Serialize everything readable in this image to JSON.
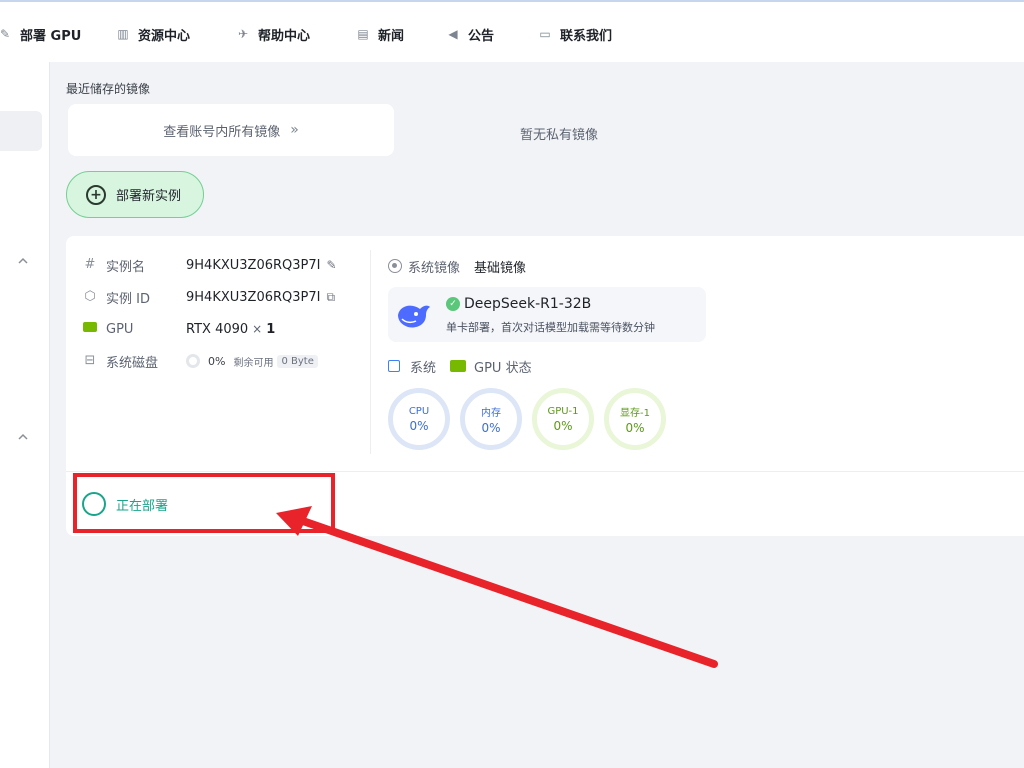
{
  "nav": {
    "items": [
      {
        "label": "部署 GPU",
        "icon": "deploy-gpu-icon"
      },
      {
        "label": "资源中心",
        "icon": "books-icon"
      },
      {
        "label": "帮助中心",
        "icon": "help-icon"
      },
      {
        "label": "新闻",
        "icon": "news-icon"
      },
      {
        "label": "公告",
        "icon": "megaphone-icon"
      },
      {
        "label": "联系我们",
        "icon": "chat-icon"
      }
    ]
  },
  "images": {
    "recent_label": "最近储存的镜像",
    "view_all": "查看账号内所有镜像",
    "no_private": "暂无私有镜像"
  },
  "deploy_button": "部署新实例",
  "instance": {
    "name_label": "实例名",
    "name": "9H4KXU3Z06RQ3P7I",
    "id_label": "实例 ID",
    "id": "9H4KXU3Z06RQ3P7I",
    "gpu_label": "GPU",
    "gpu_model": "RTX 4090",
    "gpu_times": "×",
    "gpu_count": "1",
    "disk_label": "系统磁盘",
    "disk_pct": "0%",
    "disk_remaining_label": "剩余可用",
    "disk_remaining": "0 Byte",
    "status": "正在部署"
  },
  "system_image": {
    "label": "系统镜像",
    "value": "基础镜像",
    "model_name": "DeepSeek-R1-32B",
    "model_desc": "单卡部署，首次对话模型加载需等待数分钟"
  },
  "status_header": {
    "system": "系统",
    "gpu": "GPU 状态"
  },
  "gauges": [
    {
      "label": "CPU",
      "value": "0%",
      "color": "#3b6fd6"
    },
    {
      "label": "内存",
      "value": "0%",
      "color": "#3b6fd6"
    },
    {
      "label": "GPU-1",
      "value": "0%",
      "color": "#5c9a14"
    },
    {
      "label": "显存-1",
      "value": "0%",
      "color": "#5c9a14"
    }
  ],
  "colors": {
    "accent_green": "#18a58a",
    "annotation_red": "#e8242a"
  }
}
